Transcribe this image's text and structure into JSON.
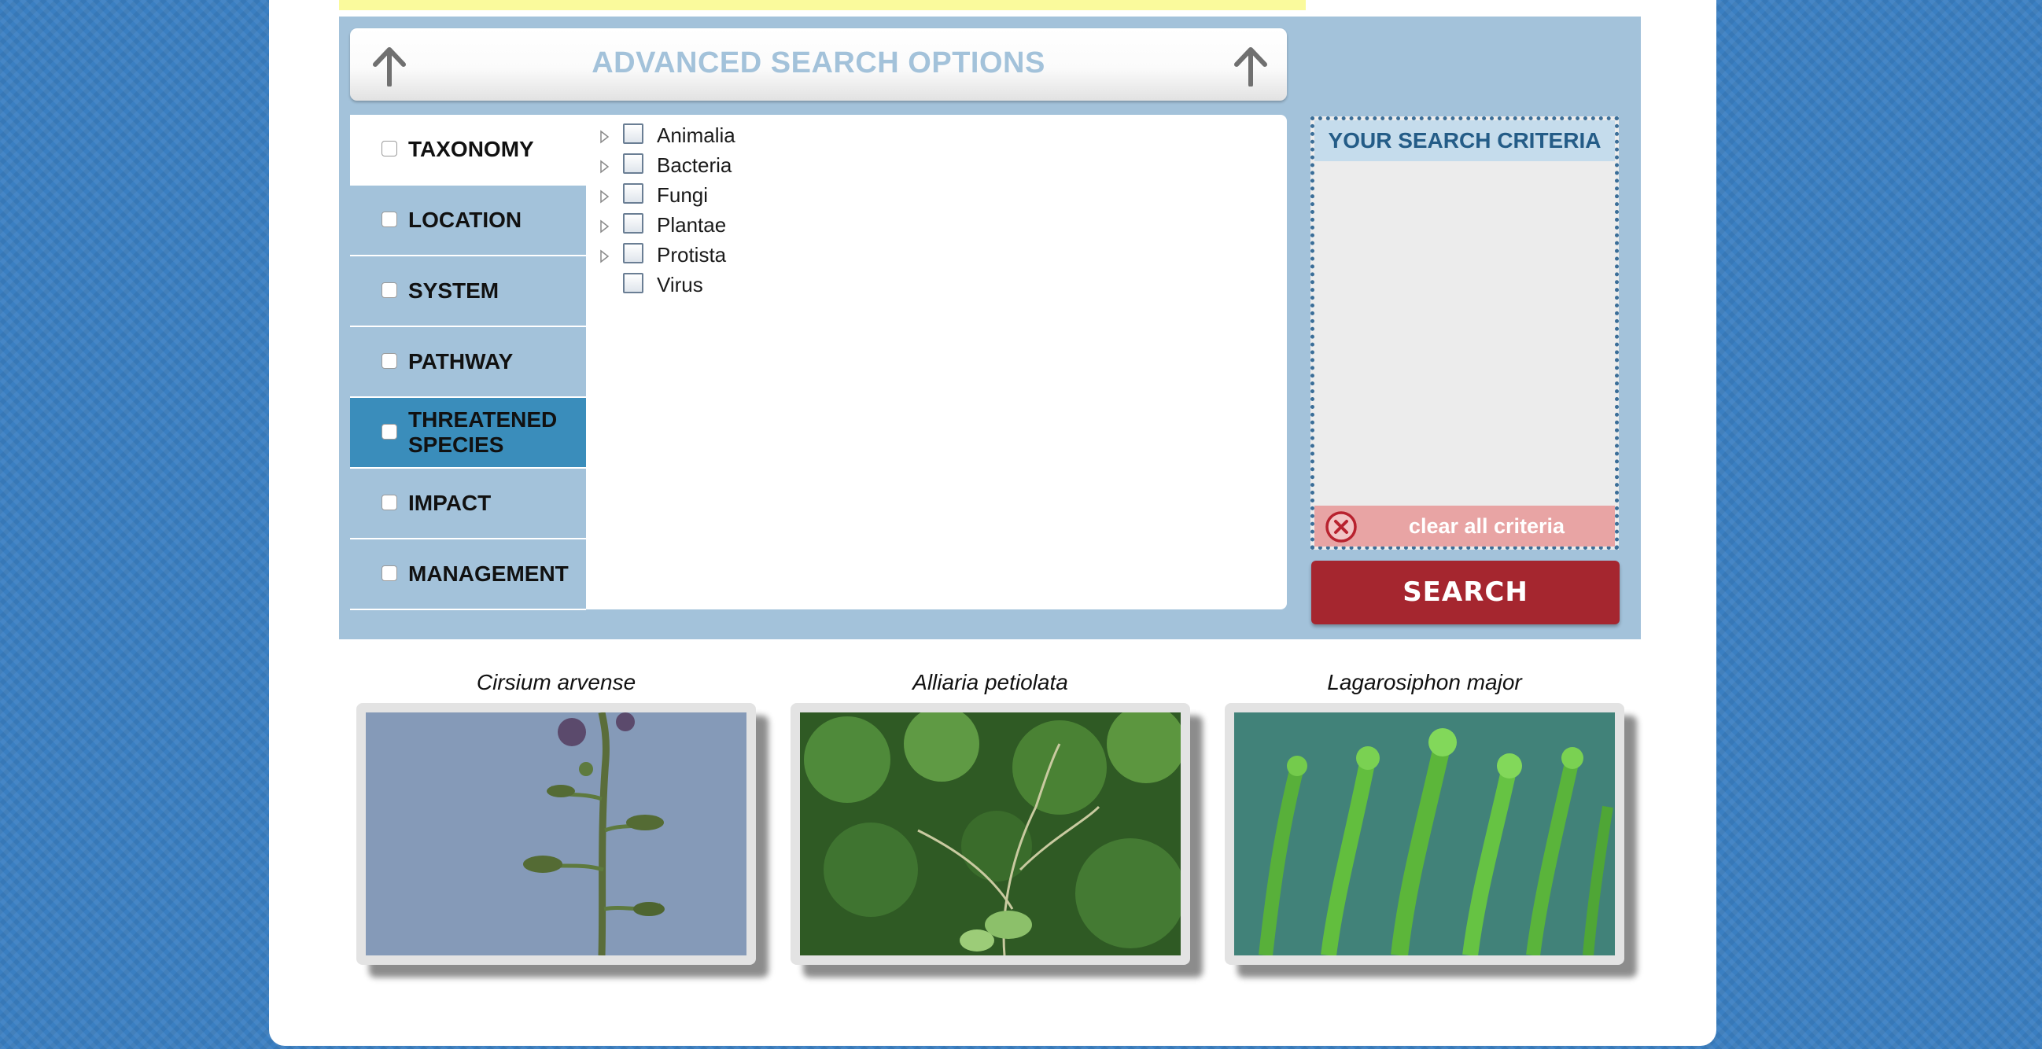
{
  "advanced_search": {
    "title": "ADVANCED SEARCH OPTIONS"
  },
  "tabs": [
    {
      "label": "TAXONOMY"
    },
    {
      "label": "LOCATION"
    },
    {
      "label": "SYSTEM"
    },
    {
      "label": "PATHWAY"
    },
    {
      "label": "THREATENED SPECIES"
    },
    {
      "label": "IMPACT"
    },
    {
      "label": "MANAGEMENT"
    }
  ],
  "taxonomy_tree": [
    {
      "label": "Animalia"
    },
    {
      "label": "Bacteria"
    },
    {
      "label": "Fungi"
    },
    {
      "label": "Plantae"
    },
    {
      "label": "Protista"
    },
    {
      "label": "Virus"
    }
  ],
  "criteria": {
    "title": "YOUR SEARCH CRITERIA",
    "clear_label": "clear all criteria"
  },
  "search_button": {
    "label": "SEARCH"
  },
  "gallery": [
    {
      "caption": "Cirsium arvense"
    },
    {
      "caption": "Alliaria petiolata"
    },
    {
      "caption": "Lagarosiphon major"
    }
  ],
  "colors": {
    "panel_bg": "#a3c2da",
    "active_tab_highlight": "#3a8dbb",
    "search_button": "#a5262f",
    "clear_bar": "#e8a4a4",
    "criteria_border": "#3b6e98"
  },
  "icons": [
    "arrow-up-icon",
    "tree-expand-icon",
    "clear-circle-x-icon"
  ]
}
